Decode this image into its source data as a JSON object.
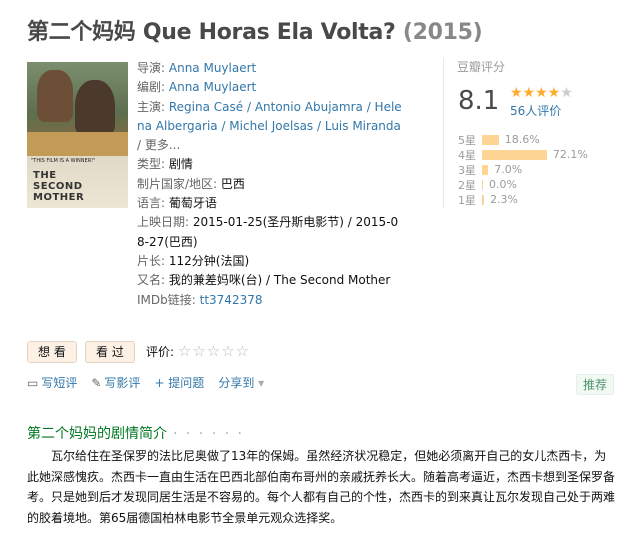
{
  "title": {
    "zh": "第二个妈妈",
    "en": "Que Horas Ela Volta?",
    "year": "(2015)"
  },
  "poster": {
    "tagline": "\"THIS FILM IS A WINNER!\"",
    "name_line1": "THE",
    "name_line2": "SECOND MOTHER"
  },
  "info": {
    "director_label": "导演:",
    "director": "Anna Muylaert",
    "writer_label": "编剧:",
    "writer": "Anna Muylaert",
    "cast_label": "主演:",
    "cast_line1": "Regina Casé / Antonio Abujamra / Hele",
    "cast_line2": "na Albergaria / Michel Joelsas / Luis Miranda",
    "cast_more": "/ 更多...",
    "genre_label": "类型:",
    "genre": "剧情",
    "country_label": "制片国家/地区:",
    "country": "巴西",
    "lang_label": "语言:",
    "lang": "葡萄牙语",
    "release_label": "上映日期:",
    "release_line1": "2015-01-25(圣丹斯电影节) / 2015-0",
    "release_line2": "8-27(巴西)",
    "runtime_label": "片长:",
    "runtime": "112分钟(法国)",
    "aka_label": "又名:",
    "aka": "我的兼差妈咪(台) / The Second Mother",
    "imdb_label": "IMDb链接:",
    "imdb": "tt3742378"
  },
  "rating": {
    "label": "豆瓣评分",
    "score": "8.1",
    "stars": 4,
    "count": "56人评价",
    "dist": [
      {
        "star": "5星",
        "pct": "18.6%",
        "value": 18.6
      },
      {
        "star": "4星",
        "pct": "72.1%",
        "value": 72.1
      },
      {
        "star": "3星",
        "pct": "7.0%",
        "value": 7.0
      },
      {
        "star": "2星",
        "pct": "0.0%",
        "value": 0.0
      },
      {
        "star": "1星",
        "pct": "2.3%",
        "value": 2.3
      }
    ]
  },
  "buttons": {
    "want": "想 看",
    "seen": "看 过",
    "eval_label": "评价:"
  },
  "actions": {
    "review_short": "写短评",
    "review": "写影评",
    "ask": "+ 提问题",
    "share": "分享到",
    "recommend": "推荐"
  },
  "summary": {
    "heading": "第二个妈妈的剧情简介",
    "dots": "· · · · · ·",
    "text": "瓦尔给住在圣保罗的法比尼奥做了13年的保姆。虽然经济状况稳定，但她必须离开自己的女儿杰西卡，为此她深感愧疚。杰西卡一直由生活在巴西北部伯南布哥州的亲戚抚养长大。随着高考逼近，杰西卡想到圣保罗备考。只是她到后才发现同居生活是不容易的。每个人都有自己的个性，杰西卡的到来真让瓦尔发现自己处于两难的胶着境地。第65届德国柏林电影节全景单元观众选择奖。"
  }
}
